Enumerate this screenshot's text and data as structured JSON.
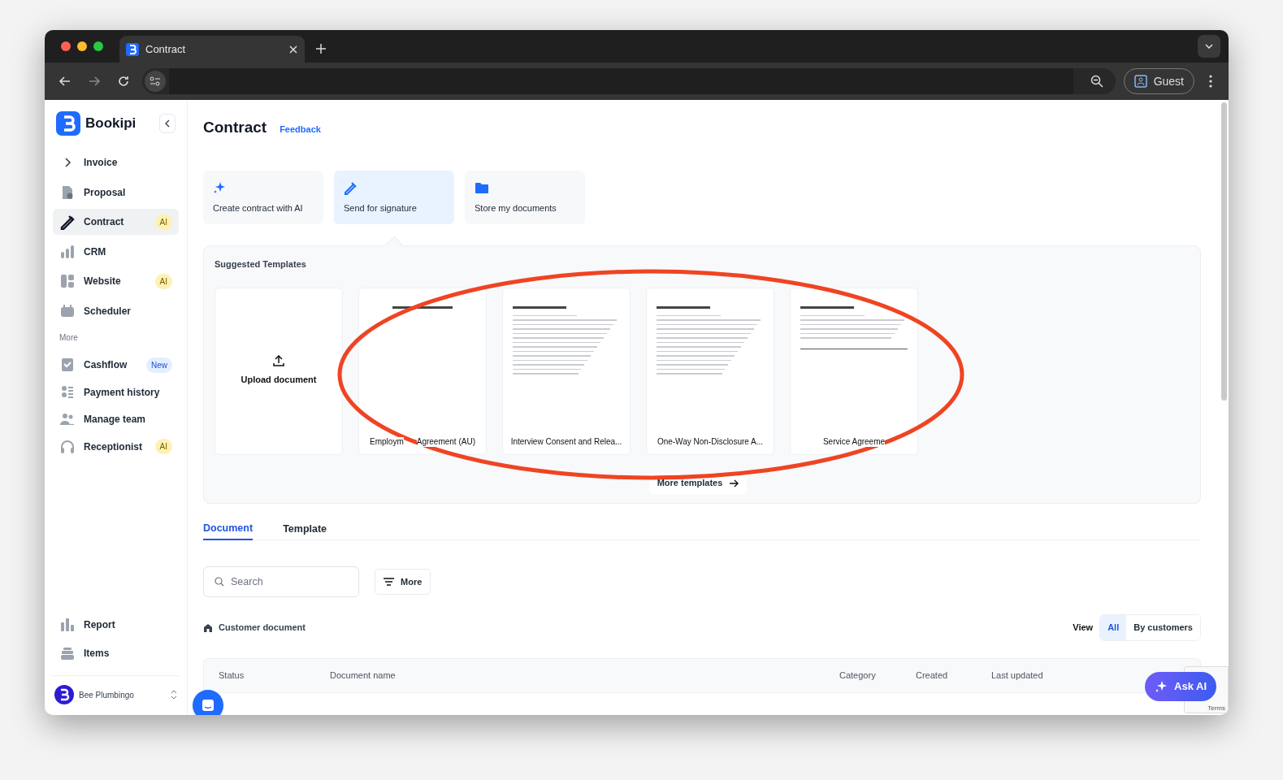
{
  "browser": {
    "tab_title": "Contract",
    "profile_label": "Guest"
  },
  "sidebar": {
    "brand": "Bookipi",
    "nav": [
      {
        "label": "Invoice",
        "selected": false
      },
      {
        "label": "Proposal",
        "selected": false
      },
      {
        "label": "Contract",
        "selected": true,
        "badge": {
          "text": "AI",
          "kind": "ai"
        }
      },
      {
        "label": "CRM",
        "selected": false
      },
      {
        "label": "Website",
        "selected": false,
        "badge": {
          "text": "AI",
          "kind": "ai"
        }
      },
      {
        "label": "Scheduler",
        "selected": false
      }
    ],
    "more_label": "More",
    "more_items": [
      {
        "label": "Cashflow",
        "selected": false,
        "badge": {
          "text": "New",
          "kind": "new"
        }
      },
      {
        "label": "Payment history",
        "selected": false
      },
      {
        "label": "Manage team",
        "selected": false
      },
      {
        "label": "Receptionist",
        "selected": false,
        "badge": {
          "text": "AI",
          "kind": "ai"
        }
      }
    ],
    "bottom_items": [
      {
        "label": "Report",
        "selected": false
      },
      {
        "label": "Items",
        "selected": false
      }
    ],
    "account": {
      "name": "Bee Plumbingo"
    }
  },
  "header": {
    "title": "Contract",
    "feedback": "Feedback"
  },
  "actions": [
    {
      "label": "Create contract with AI",
      "selected": false
    },
    {
      "label": "Send for signature",
      "selected": true
    },
    {
      "label": "Store my documents",
      "selected": false
    }
  ],
  "templates": {
    "title": "Suggested Templates",
    "upload_label": "Upload document",
    "items": [
      {
        "title_parts": [
          "Employm",
          "Agreement (AU)"
        ]
      },
      {
        "title_parts": [
          "Interview Consent and Relea..."
        ]
      },
      {
        "title_parts": [
          "One-Way Non-Disclosure A..."
        ]
      },
      {
        "title_parts": [
          "Service Agreeme"
        ]
      }
    ],
    "more_button": "More templates"
  },
  "tabs": [
    {
      "label": "Document",
      "selected": true
    },
    {
      "label": "Template",
      "selected": false
    }
  ],
  "search": {
    "placeholder": "Search"
  },
  "filter_button": "More",
  "section": {
    "title": "Customer document",
    "view_label": "View",
    "view_options": [
      {
        "label": "All",
        "selected": true
      },
      {
        "label": "By customers",
        "selected": false
      }
    ]
  },
  "table": {
    "columns": [
      "Status",
      "Document name",
      "Category",
      "Created",
      "Last updated"
    ]
  },
  "ask_ai": "Ask AI",
  "recaptcha_text": "Terms"
}
